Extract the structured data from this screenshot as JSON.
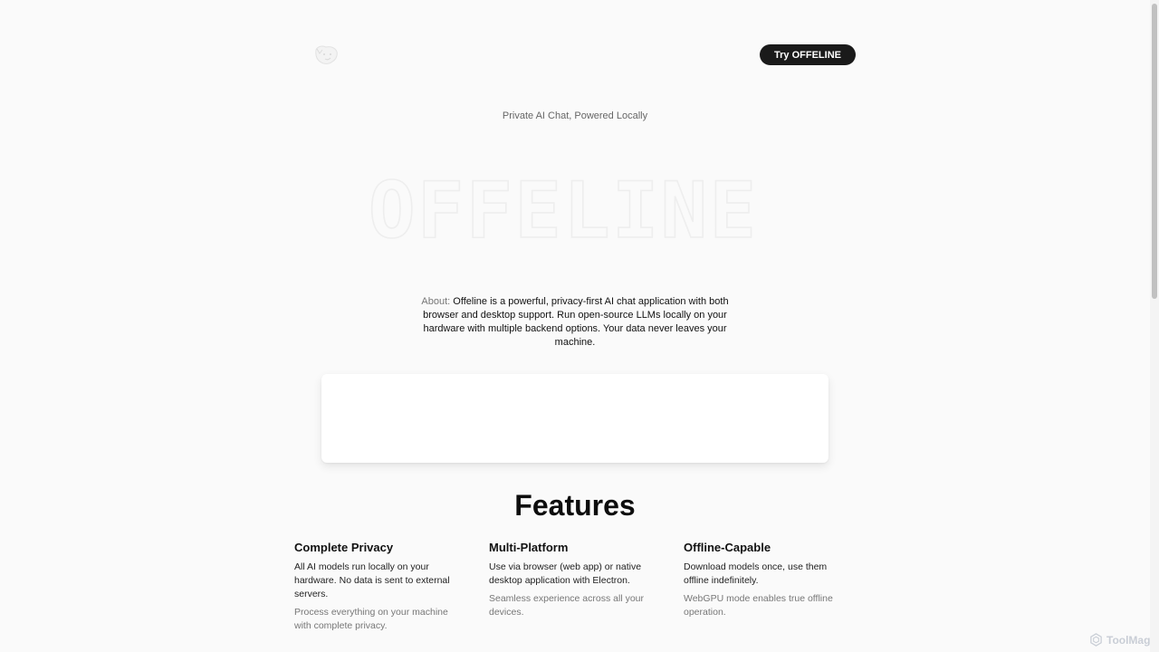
{
  "header": {
    "logo_icon": "dog-logo-icon",
    "cta_label": "Try OFFELINE"
  },
  "hero": {
    "tagline": "Private AI Chat, Powered Locally",
    "title": "OFFELINE"
  },
  "about": {
    "label": "About:",
    "text": "Offeline is a powerful, privacy-first AI chat application with both browser and desktop support. Run open-source LLMs locally on your hardware with multiple backend options. Your data never leaves your machine."
  },
  "features": {
    "title": "Features",
    "items": [
      {
        "title": "Complete Privacy",
        "description": "All AI models run locally on your hardware. No data is sent to external servers.",
        "detail": "Process everything on your machine with complete privacy."
      },
      {
        "title": "Multi-Platform",
        "description": "Use via browser (web app) or native desktop application with Electron.",
        "detail": "Seamless experience across all your devices."
      },
      {
        "title": "Offline-Capable",
        "description": "Download models once, use them offline indefinitely.",
        "detail": "WebGPU mode enables true offline operation."
      }
    ]
  },
  "watermark": {
    "text": "ToolMage",
    "icon": "toolmage-logo-icon"
  },
  "colors": {
    "background": "#fafafa",
    "button": "#1a1a1a",
    "button_text": "#ffffff"
  }
}
